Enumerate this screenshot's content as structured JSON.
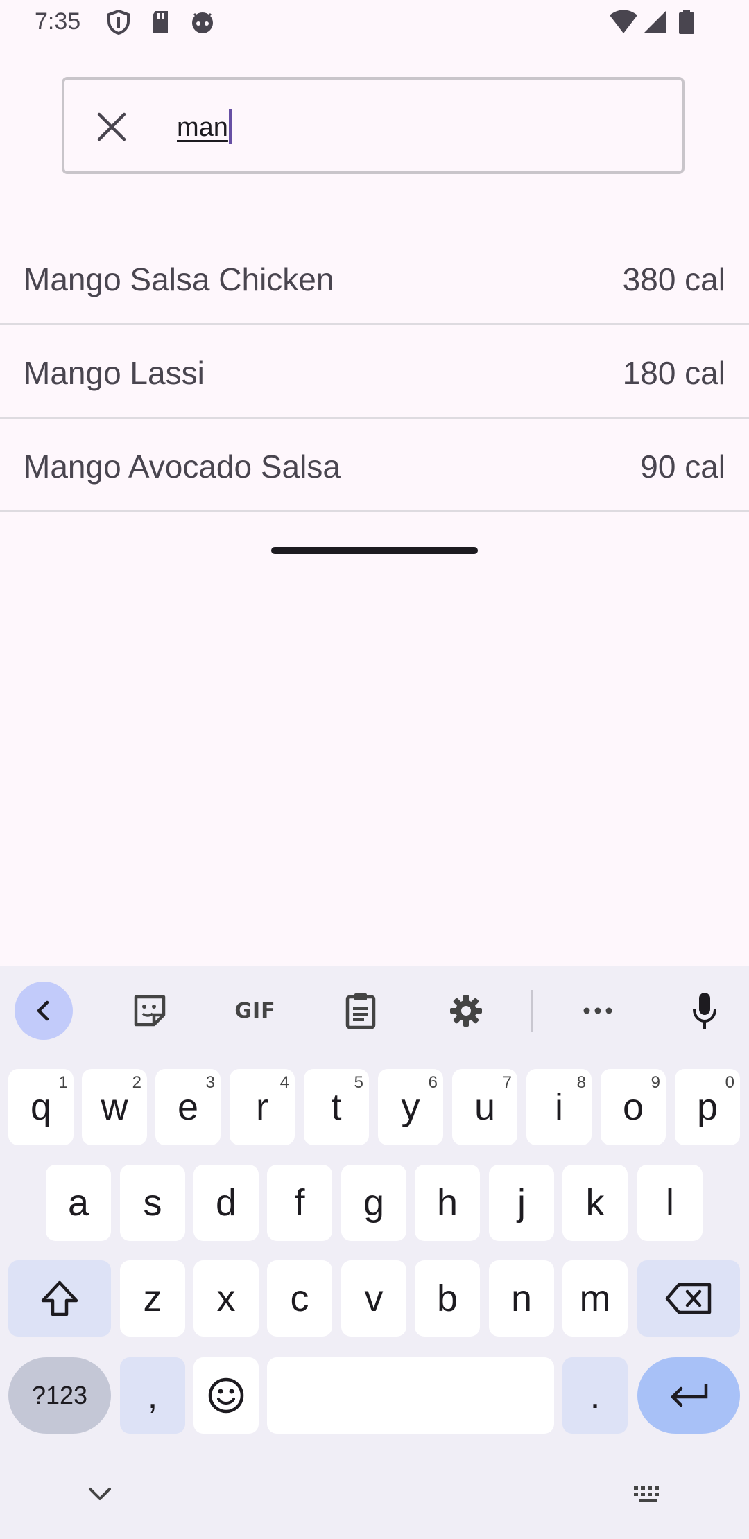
{
  "status_bar": {
    "time": "7:35"
  },
  "search": {
    "value": "man"
  },
  "results": [
    {
      "name": "Mango Salsa Chicken",
      "calories": "380 cal"
    },
    {
      "name": "Mango Lassi",
      "calories": "180 cal"
    },
    {
      "name": "Mango Avocado Salsa",
      "calories": "90 cal"
    }
  ],
  "keyboard": {
    "toolbar": {
      "gif": "GIF"
    },
    "row1": [
      {
        "k": "q",
        "h": "1"
      },
      {
        "k": "w",
        "h": "2"
      },
      {
        "k": "e",
        "h": "3"
      },
      {
        "k": "r",
        "h": "4"
      },
      {
        "k": "t",
        "h": "5"
      },
      {
        "k": "y",
        "h": "6"
      },
      {
        "k": "u",
        "h": "7"
      },
      {
        "k": "i",
        "h": "8"
      },
      {
        "k": "o",
        "h": "9"
      },
      {
        "k": "p",
        "h": "0"
      }
    ],
    "row2": [
      "a",
      "s",
      "d",
      "f",
      "g",
      "h",
      "j",
      "k",
      "l"
    ],
    "row3": [
      "z",
      "x",
      "c",
      "v",
      "b",
      "n",
      "m"
    ],
    "row4": {
      "symbols": "?123",
      "comma": ",",
      "period": "."
    }
  },
  "colors": {
    "background": "#fef7fc",
    "accent": "#6750a4",
    "enter_key": "#a8c1f7"
  }
}
